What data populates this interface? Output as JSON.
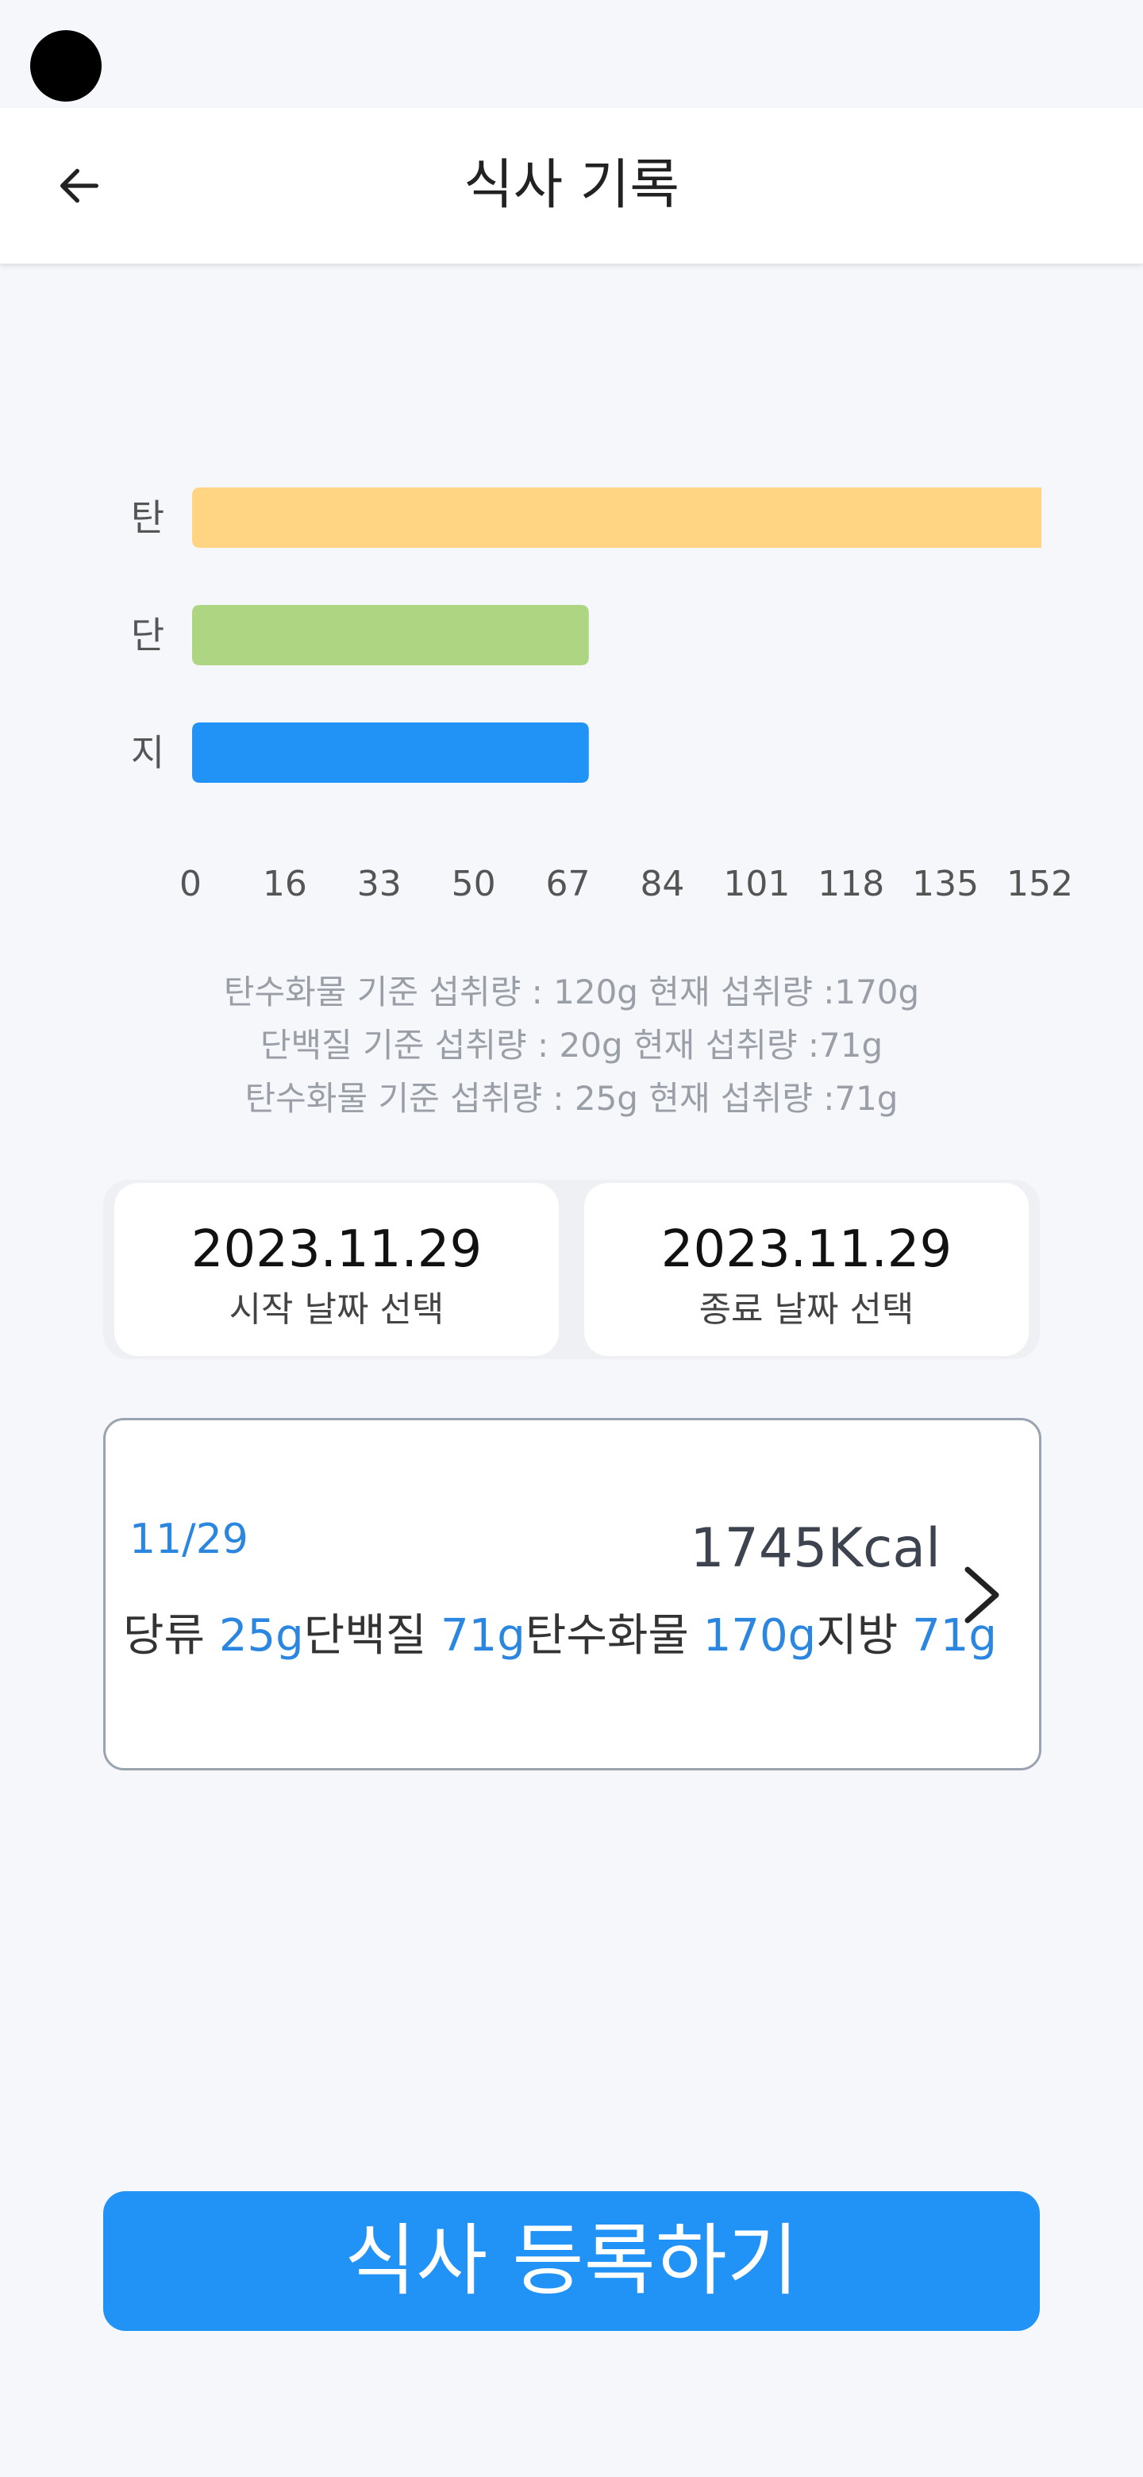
{
  "app_bar": {
    "title": "식사 기록",
    "back_icon": "arrow-left-icon"
  },
  "chart_data": {
    "type": "bar",
    "orientation": "horizontal",
    "categories": [
      "탄",
      "단",
      "지"
    ],
    "values": [
      170,
      71,
      71
    ],
    "colors": [
      "#ffd482",
      "#aed581",
      "#2192f6"
    ],
    "xlim": [
      0,
      152
    ],
    "xticks": [
      "0",
      "16",
      "33",
      "50",
      "67",
      "84",
      "101",
      "118",
      "135",
      "152"
    ],
    "title": "",
    "xlabel": "",
    "ylabel": ""
  },
  "info": {
    "lines": [
      "탄수화물 기준 섭취량 : 120g 현재 섭취량 :170g",
      "단백질 기준 섭취량 : 20g 현재 섭취량 :71g",
      "탄수화물 기준 섭취량 : 25g 현재 섭취량 :71g"
    ]
  },
  "dates": {
    "start": {
      "value": "2023.11.29",
      "label": "시작 날짜 선택"
    },
    "end": {
      "value": "2023.11.29",
      "label": "종료 날짜 선택"
    }
  },
  "meal": {
    "date": "11/29",
    "kcal": "1745Kcal",
    "chevron_icon": "chevron-right-icon",
    "nutrients": [
      {
        "label": "당류",
        "value": "25g"
      },
      {
        "label": "단백질",
        "value": "71g"
      },
      {
        "label": "탄수화물",
        "value": "170g"
      },
      {
        "label": "지방",
        "value": "71g"
      }
    ]
  },
  "register_button": {
    "label": "식사 등록하기"
  }
}
